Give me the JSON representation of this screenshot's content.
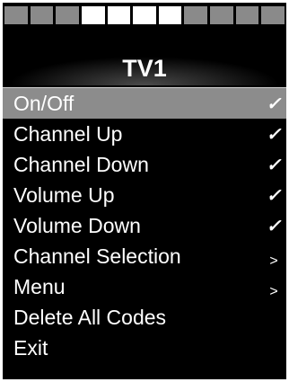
{
  "progress": {
    "total_segments": 11,
    "filled_segments": [
      4,
      5,
      6,
      7
    ]
  },
  "header": {
    "title": "TV1"
  },
  "menu": {
    "items": [
      {
        "label": "On/Off",
        "mark": "✓",
        "selected": true
      },
      {
        "label": "Channel Up",
        "mark": "✓"
      },
      {
        "label": "Channel Down",
        "mark": "✓"
      },
      {
        "label": "Volume Up",
        "mark": "✓"
      },
      {
        "label": "Volume Down",
        "mark": "✓"
      },
      {
        "label": "Channel Selection",
        "mark": ">"
      },
      {
        "label": "Menu",
        "mark": ">"
      },
      {
        "label": "Delete All Codes",
        "mark": ""
      },
      {
        "label": "Exit",
        "mark": ""
      }
    ]
  },
  "colors": {
    "background": "#000000",
    "highlight": "#8c8c8c",
    "segment_empty": "#8a8a8a",
    "segment_filled": "#ffffff",
    "text": "#ffffff"
  }
}
